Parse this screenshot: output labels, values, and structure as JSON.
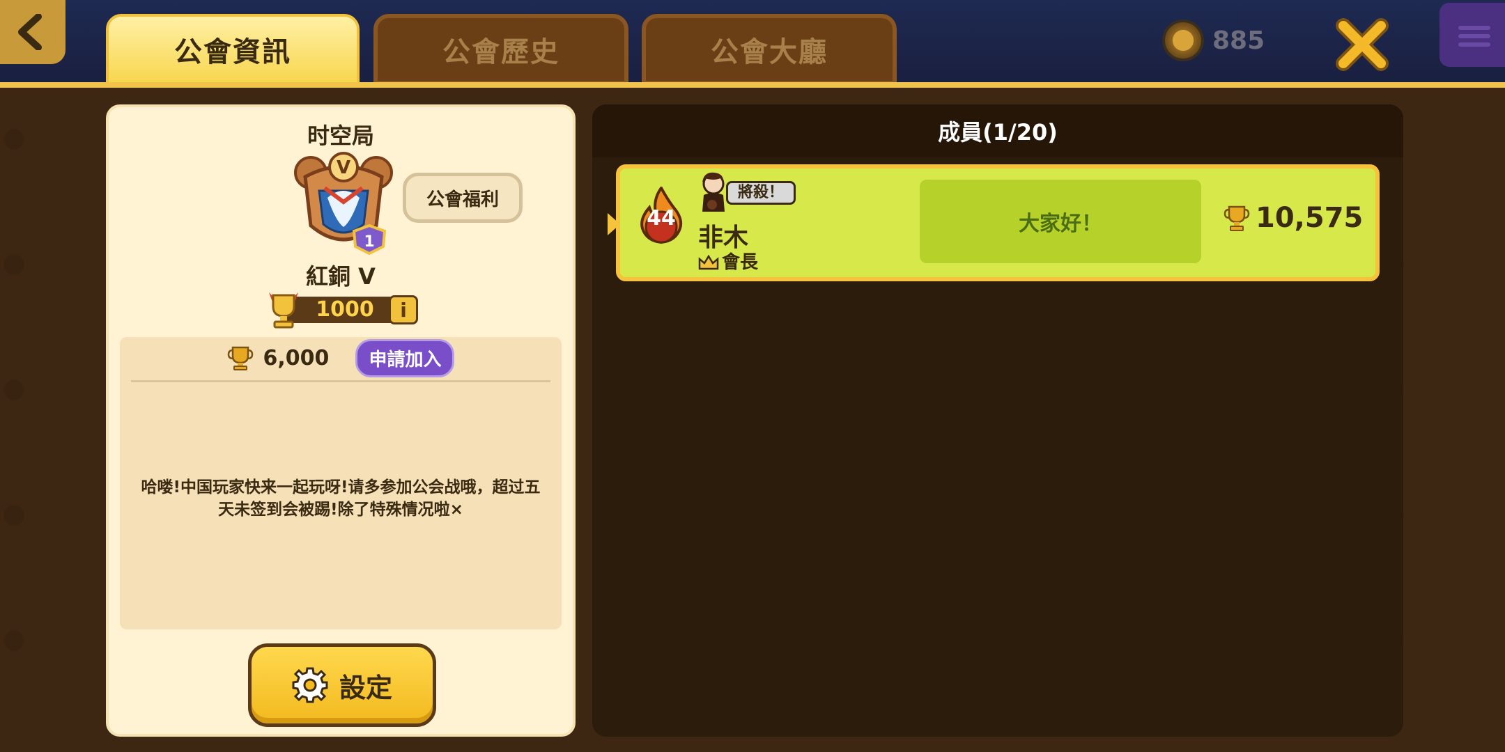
{
  "top": {
    "tabs": [
      {
        "label": "公會資訊",
        "active": true
      },
      {
        "label": "公會歷史",
        "active": false
      },
      {
        "label": "公會大廳",
        "active": false
      }
    ],
    "currency_value": "885",
    "icons": {
      "back": "chevron-left-icon",
      "close": "close-icon",
      "coin": "coin-icon",
      "menu": "menu-icon"
    }
  },
  "guild": {
    "name": "时空局",
    "rank_name": "紅銅 V",
    "emblem_letter": "V",
    "emblem_level": "1",
    "benefit_button": "公會福利",
    "rank_points": "1000",
    "info_label": "i",
    "required_trophies": "6,000",
    "join_type": "申請加入",
    "description": "哈喽!中国玩家快来一起玩呀!请多参加公会战哦，超过五天未签到会被踢!除了特殊情况啦×",
    "settings_button": "設定"
  },
  "members": {
    "header": "成員(1/20)",
    "list": [
      {
        "level": "44",
        "title_tag": "將殺！",
        "name": "非木",
        "role": "會長",
        "greeting": "大家好！",
        "trophies": "10,575"
      }
    ]
  },
  "colors": {
    "accent_yellow": "#f6c33c",
    "card_green": "#d7e84b",
    "apply_purple": "#7a4ec9",
    "panel_cream": "#fff3d4"
  }
}
